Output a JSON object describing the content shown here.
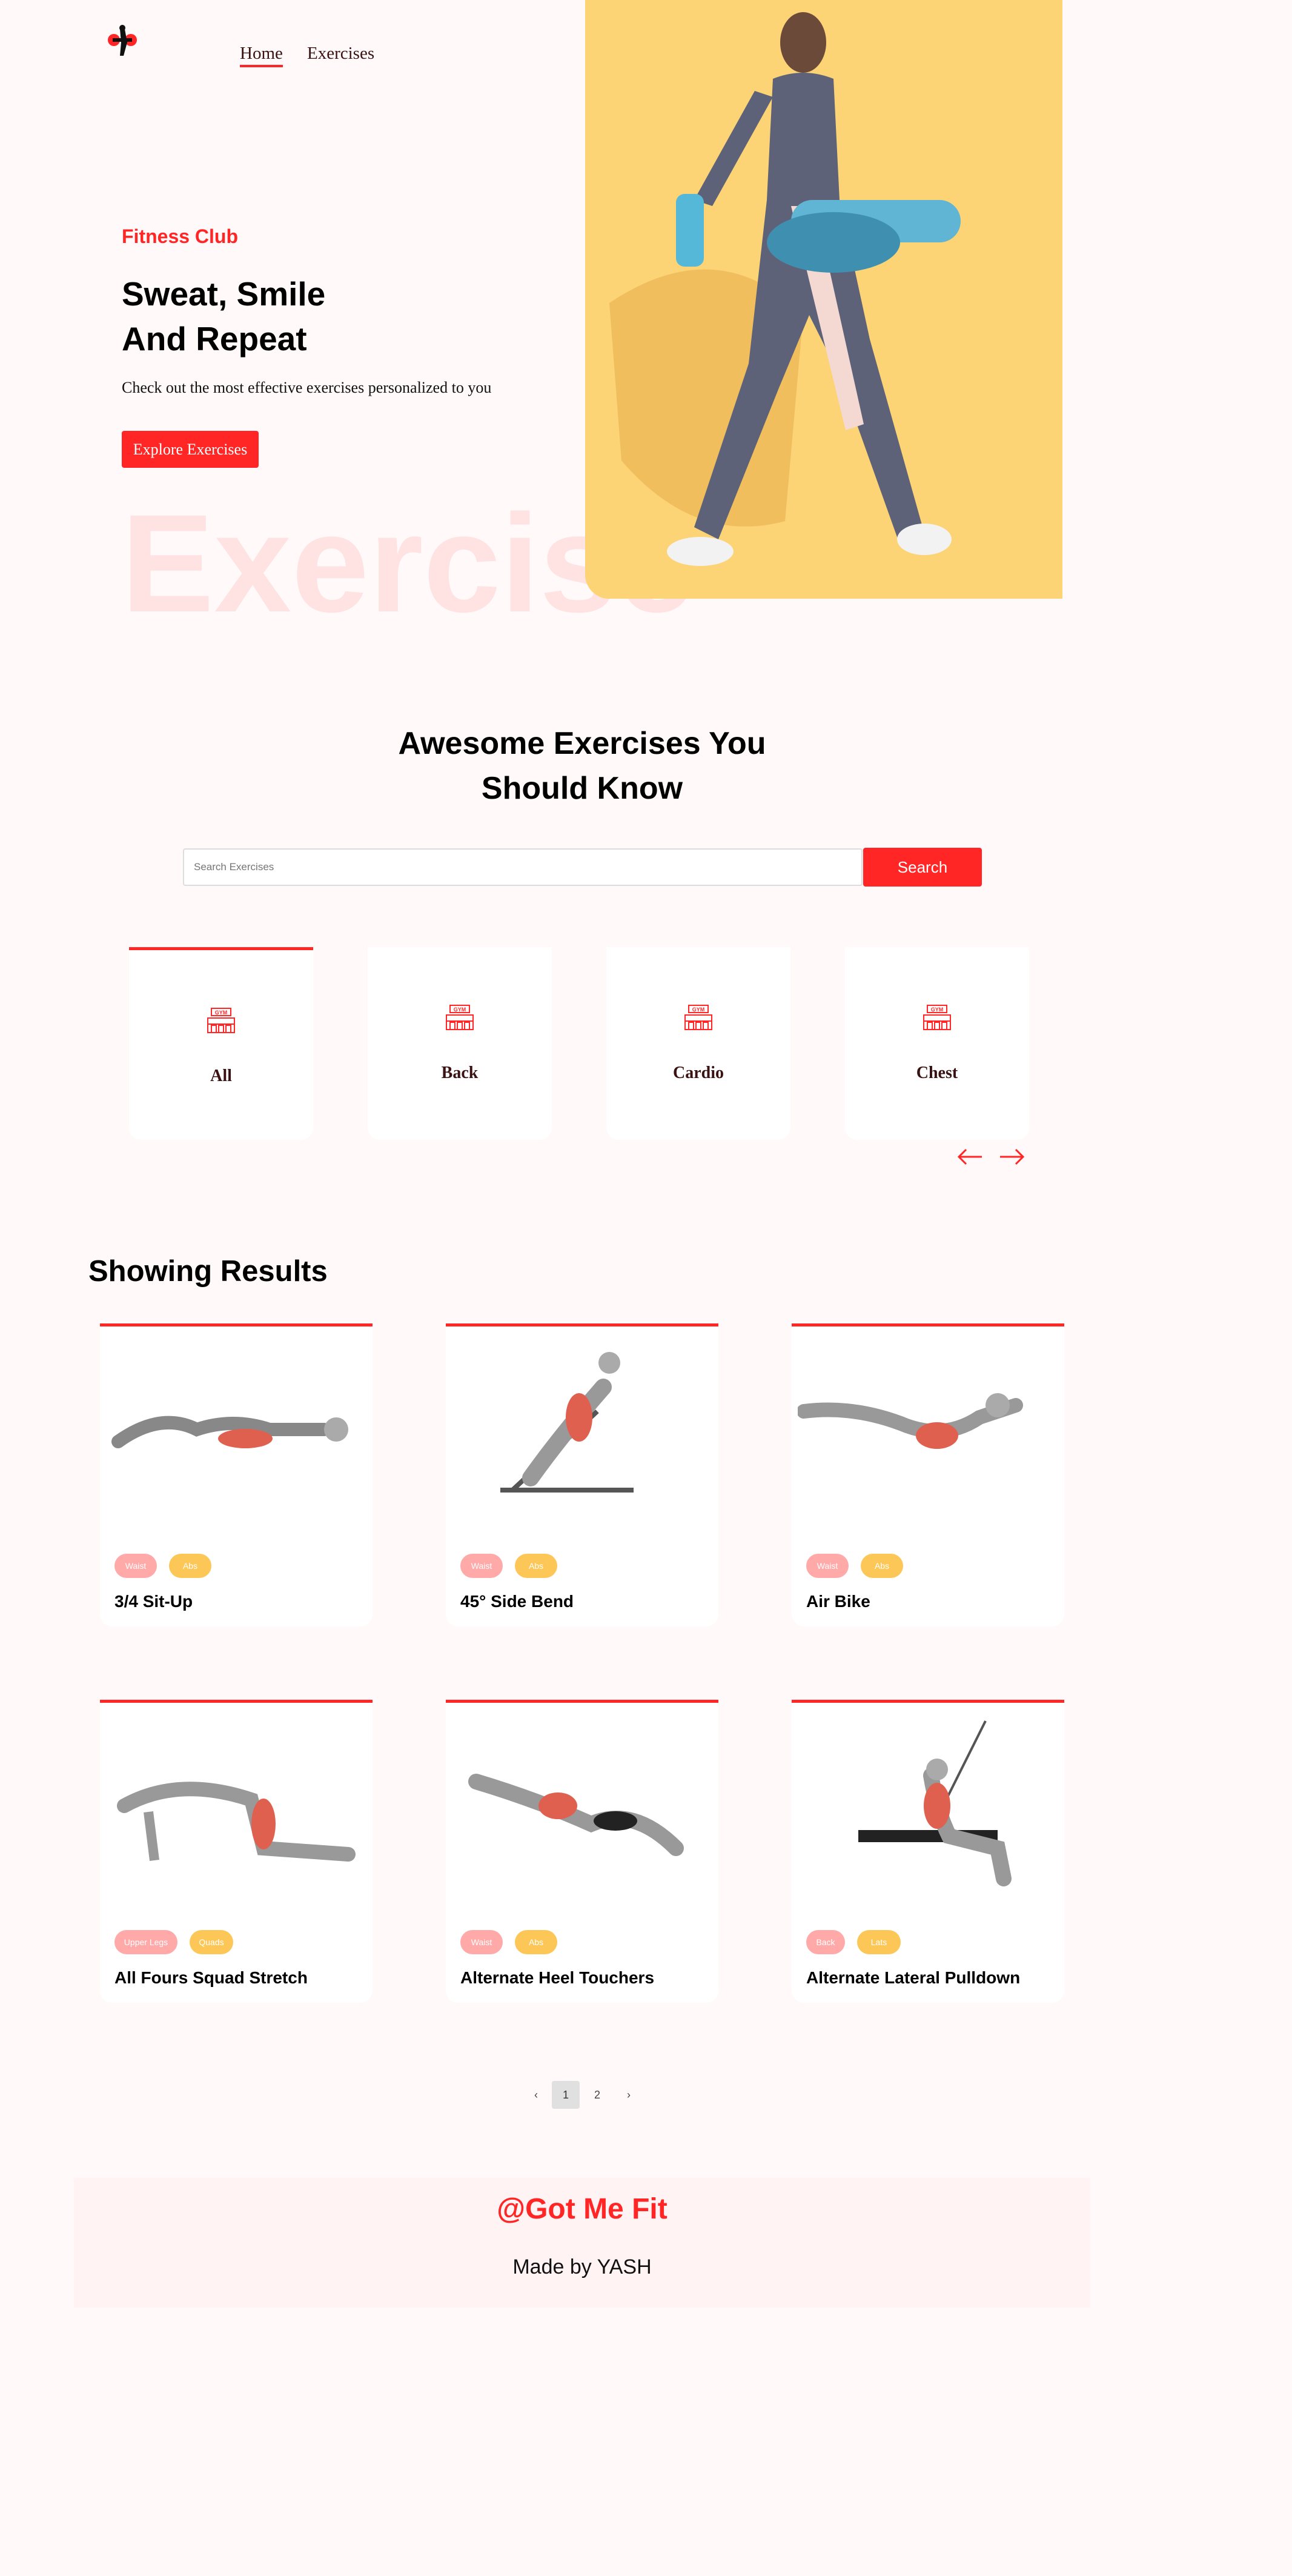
{
  "nav": {
    "home": "Home",
    "exercises": "Exercises"
  },
  "hero": {
    "tag": "Fitness Club",
    "title_line1": "Sweat, Smile",
    "title_line2": "And Repeat",
    "description": "Check out the most effective exercises personalized to you",
    "cta": "Explore Exercises",
    "bg_text": "Exercise"
  },
  "search": {
    "title_line1": "Awesome Exercises You",
    "title_line2": "Should Know",
    "placeholder": "Search Exercises",
    "button": "Search"
  },
  "categories": [
    {
      "label": "All",
      "icon_text": "GYM"
    },
    {
      "label": "Back",
      "icon_text": "GYM"
    },
    {
      "label": "Cardio",
      "icon_text": "GYM"
    },
    {
      "label": "Chest",
      "icon_text": "GYM"
    }
  ],
  "results": {
    "title": "Showing Results",
    "items": [
      {
        "name": "3/4 Sit-Up",
        "tags": [
          "Waist",
          "Abs"
        ]
      },
      {
        "name": "45° Side Bend",
        "tags": [
          "Waist",
          "Abs"
        ]
      },
      {
        "name": "Air Bike",
        "tags": [
          "Waist",
          "Abs"
        ]
      },
      {
        "name": "All Fours Squad Stretch",
        "tags": [
          "Upper Legs",
          "Quads"
        ]
      },
      {
        "name": "Alternate Heel Touchers",
        "tags": [
          "Waist",
          "Abs"
        ]
      },
      {
        "name": "Alternate Lateral Pulldown",
        "tags": [
          "Back",
          "Lats"
        ]
      }
    ]
  },
  "pagination": {
    "prev": "‹",
    "page1": "1",
    "page2": "2",
    "next": "›"
  },
  "footer": {
    "brand": "@Got Me Fit",
    "credit": "Made by YASH"
  },
  "colors": {
    "accent": "#ff2625",
    "hero_bg": "#fcd375",
    "badge_primary": "#ffa9a9",
    "badge_secondary": "#fcc757"
  }
}
